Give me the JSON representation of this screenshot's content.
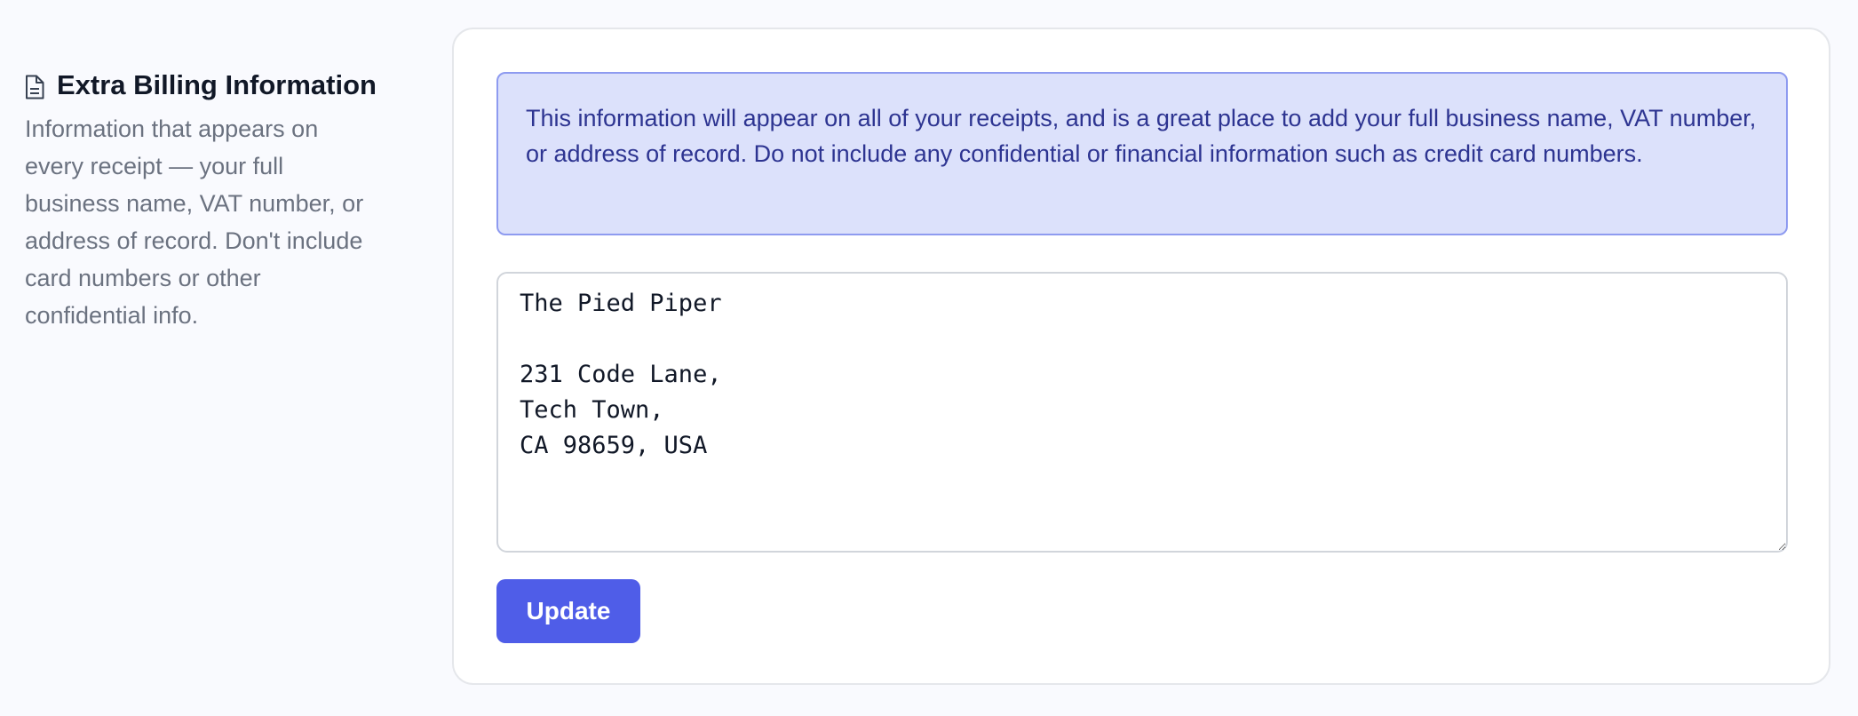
{
  "section": {
    "icon": "document-icon",
    "title": "Extra Billing Information",
    "description": "Information that appears on every receipt — your full business name, VAT number, or address of record. Don't include card numbers or other confidential info."
  },
  "notice": {
    "text": "This information will appear on all of your receipts, and is a great place to add your full business name, VAT number, or address of record. Do not include any confidential or financial information such as credit card numbers."
  },
  "billing_info": {
    "value": "The Pied Piper\n\n231 Code Lane,\nTech Town,\nCA 98659, USA"
  },
  "actions": {
    "update_label": "Update"
  },
  "colors": {
    "accent": "#4f5de8",
    "notice_bg": "#dce1fb",
    "notice_text": "#2d3491"
  }
}
